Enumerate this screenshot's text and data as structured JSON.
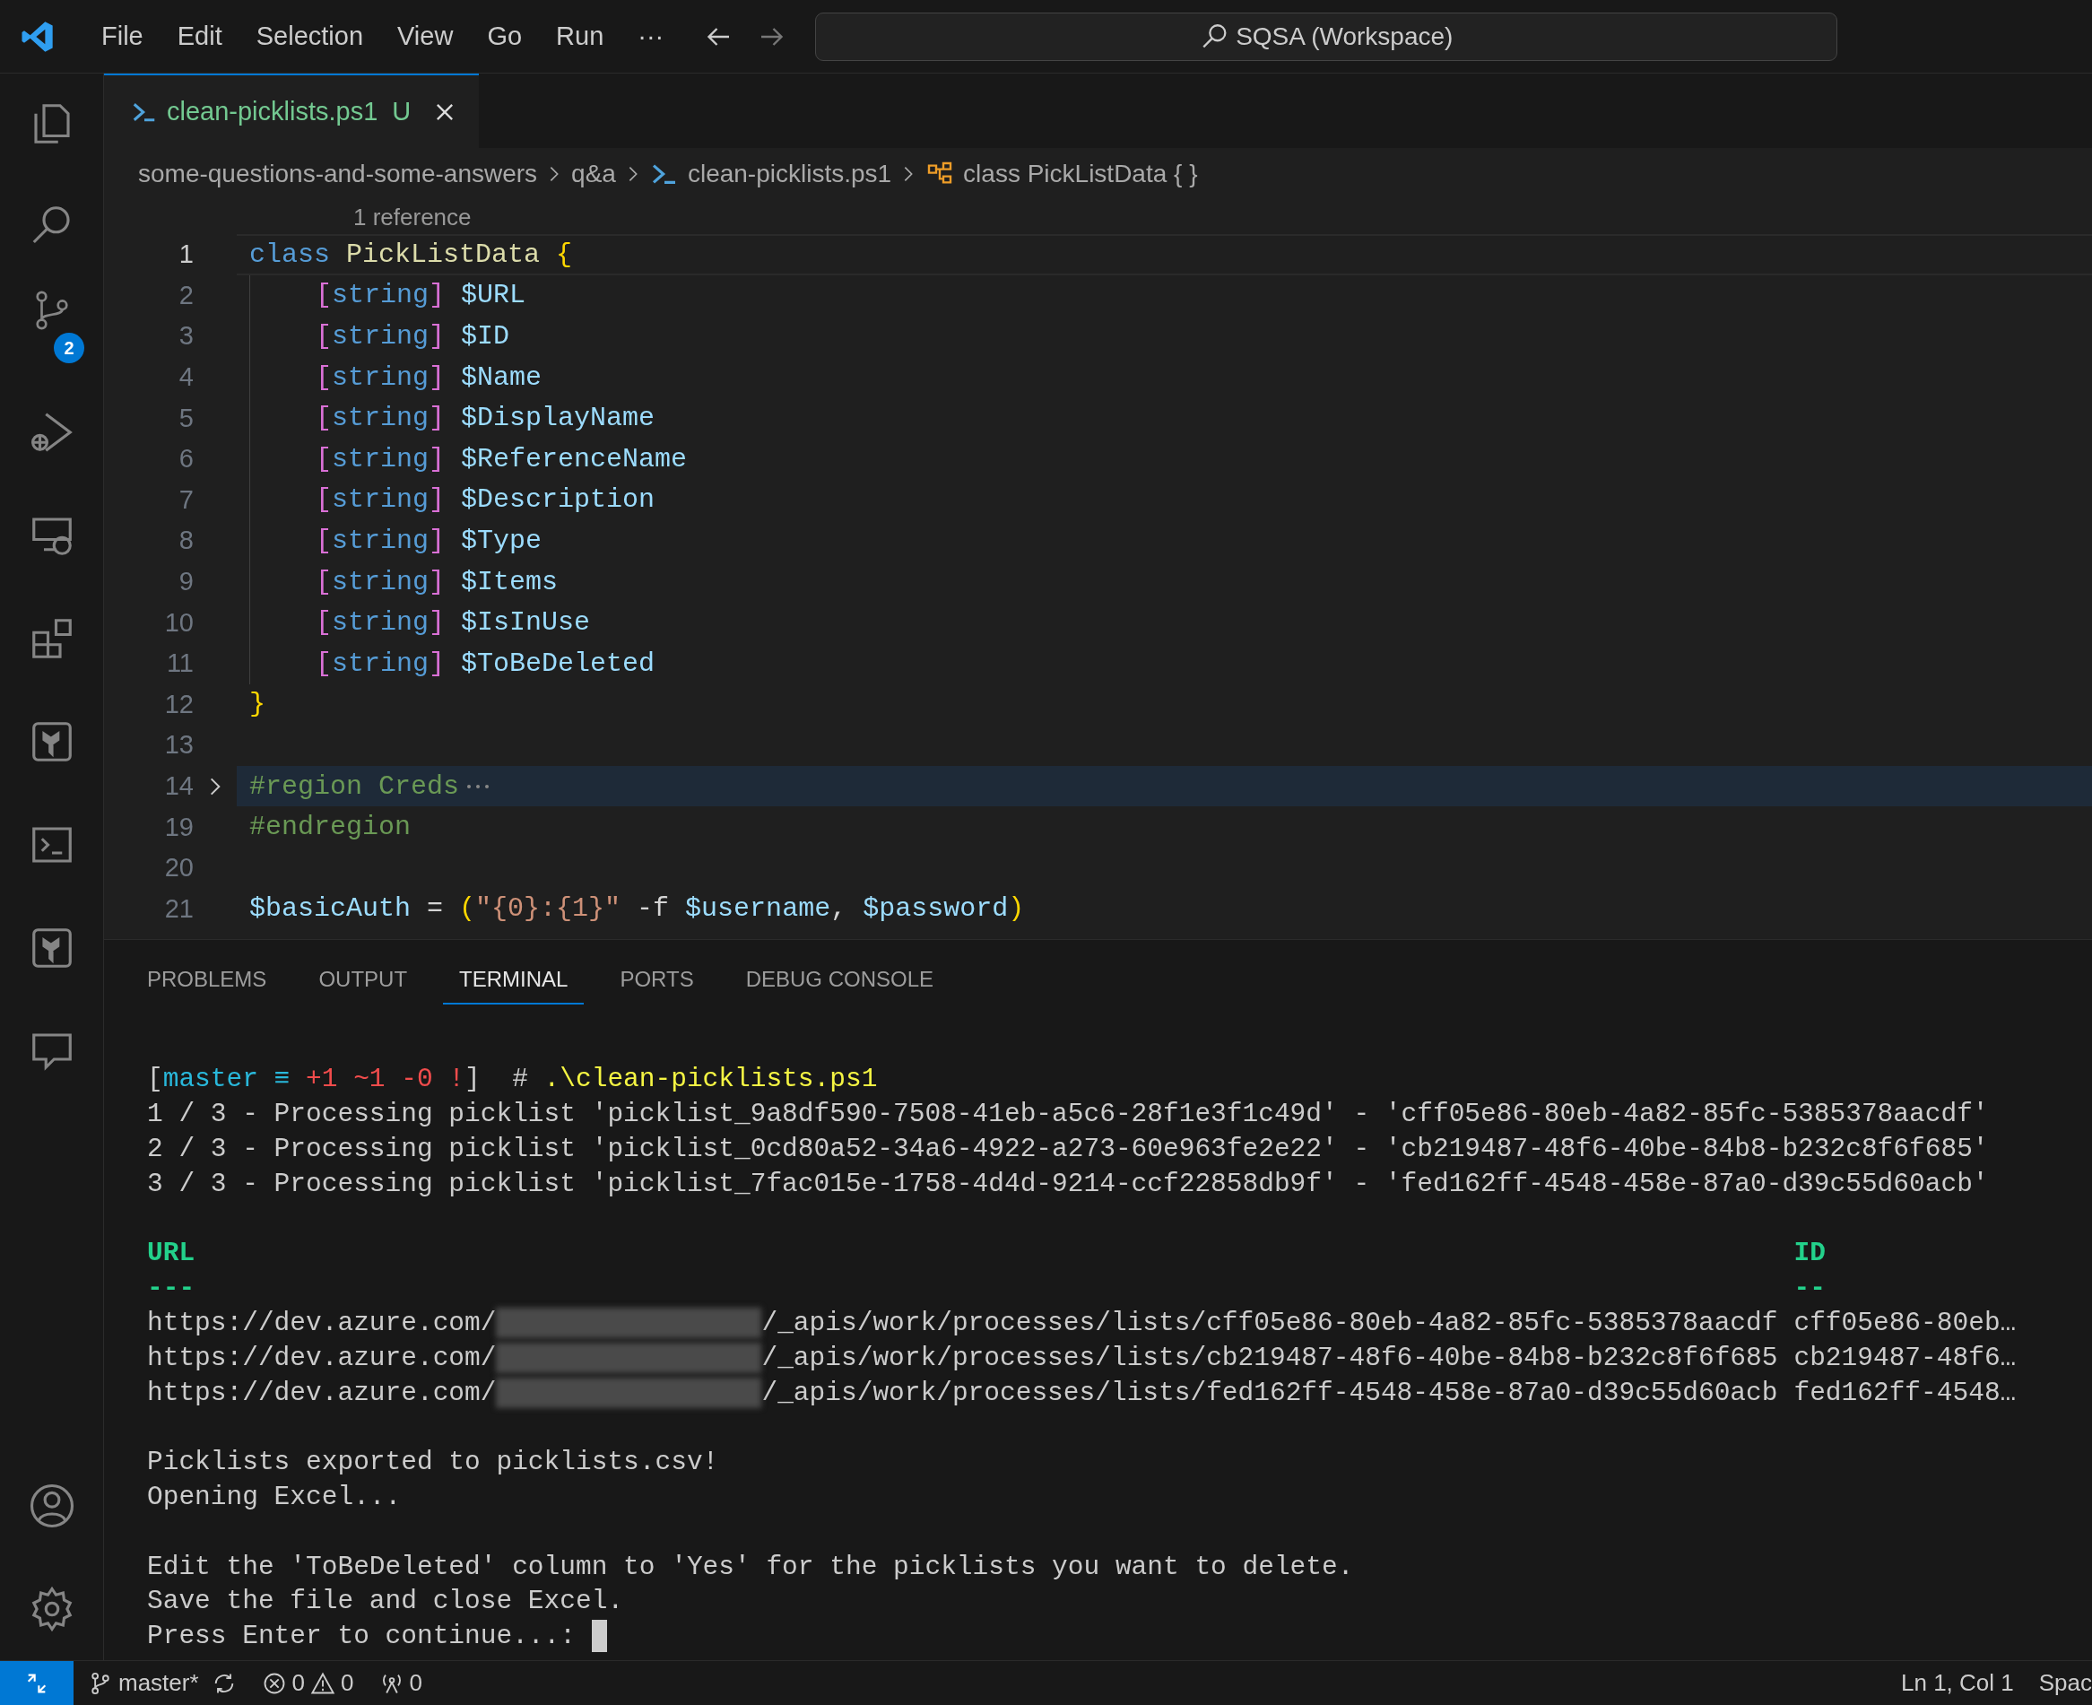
{
  "title_bar": {
    "menu": [
      "File",
      "Edit",
      "Selection",
      "View",
      "Go",
      "Run",
      "···"
    ],
    "search": "SQSA (Workspace)"
  },
  "activity_bar": {
    "items": [
      {
        "kind": "explorer"
      },
      {
        "kind": "search"
      },
      {
        "kind": "source-control",
        "badge": "2"
      },
      {
        "kind": "run-debug"
      },
      {
        "kind": "remote"
      },
      {
        "kind": "extensions"
      },
      {
        "kind": "terraform-cloud"
      },
      {
        "kind": "terminal"
      },
      {
        "kind": "terraform"
      },
      {
        "kind": "feedback"
      }
    ],
    "bottom": [
      {
        "kind": "account"
      },
      {
        "kind": "settings"
      }
    ]
  },
  "tabs": [
    {
      "label": "clean-picklists.ps1",
      "status": "U",
      "selected": true
    }
  ],
  "breadcrumbs": [
    {
      "kind": "folder",
      "label": "some-questions-and-some-answers"
    },
    {
      "kind": "folder",
      "label": "q&a"
    },
    {
      "kind": "file",
      "label": "clean-picklists.ps1"
    },
    {
      "kind": "class",
      "label": "class PickListData { }"
    }
  ],
  "codelens": "1 reference",
  "code": [
    {
      "number": "1",
      "current": true,
      "folded": false,
      "indented": false,
      "tokens": [
        {
          "text": "class",
          "kind": "keyword"
        },
        {
          "text": " PickListData ",
          "kind": "name"
        },
        {
          "text": "{",
          "kind": "brace"
        }
      ]
    },
    {
      "number": "2",
      "current": false,
      "folded": false,
      "indented": true,
      "tokens": [
        {
          "text": "[",
          "kind": "bracket"
        },
        {
          "text": "string",
          "kind": "type"
        },
        {
          "text": "]",
          "kind": "bracket"
        },
        {
          "text": " $URL",
          "kind": "var"
        }
      ]
    },
    {
      "number": "3",
      "current": false,
      "folded": false,
      "indented": true,
      "tokens": [
        {
          "text": "[",
          "kind": "bracket"
        },
        {
          "text": "string",
          "kind": "type"
        },
        {
          "text": "]",
          "kind": "bracket"
        },
        {
          "text": " $ID",
          "kind": "var"
        }
      ]
    },
    {
      "number": "4",
      "current": false,
      "folded": false,
      "indented": true,
      "tokens": [
        {
          "text": "[",
          "kind": "bracket"
        },
        {
          "text": "string",
          "kind": "type"
        },
        {
          "text": "]",
          "kind": "bracket"
        },
        {
          "text": " $Name",
          "kind": "var"
        }
      ]
    },
    {
      "number": "5",
      "current": false,
      "folded": false,
      "indented": true,
      "tokens": [
        {
          "text": "[",
          "kind": "bracket"
        },
        {
          "text": "string",
          "kind": "type"
        },
        {
          "text": "]",
          "kind": "bracket"
        },
        {
          "text": " $DisplayName",
          "kind": "var"
        }
      ]
    },
    {
      "number": "6",
      "current": false,
      "folded": false,
      "indented": true,
      "tokens": [
        {
          "text": "[",
          "kind": "bracket"
        },
        {
          "text": "string",
          "kind": "type"
        },
        {
          "text": "]",
          "kind": "bracket"
        },
        {
          "text": " $ReferenceName",
          "kind": "var"
        }
      ]
    },
    {
      "number": "7",
      "current": false,
      "folded": false,
      "indented": true,
      "tokens": [
        {
          "text": "[",
          "kind": "bracket"
        },
        {
          "text": "string",
          "kind": "type"
        },
        {
          "text": "]",
          "kind": "bracket"
        },
        {
          "text": " $Description",
          "kind": "var"
        }
      ]
    },
    {
      "number": "8",
      "current": false,
      "folded": false,
      "indented": true,
      "tokens": [
        {
          "text": "[",
          "kind": "bracket"
        },
        {
          "text": "string",
          "kind": "type"
        },
        {
          "text": "]",
          "kind": "bracket"
        },
        {
          "text": " $Type",
          "kind": "var"
        }
      ]
    },
    {
      "number": "9",
      "current": false,
      "folded": false,
      "indented": true,
      "tokens": [
        {
          "text": "[",
          "kind": "bracket"
        },
        {
          "text": "string",
          "kind": "type"
        },
        {
          "text": "]",
          "kind": "bracket"
        },
        {
          "text": " $Items",
          "kind": "var"
        }
      ]
    },
    {
      "number": "10",
      "current": false,
      "folded": false,
      "indented": true,
      "tokens": [
        {
          "text": "[",
          "kind": "bracket"
        },
        {
          "text": "string",
          "kind": "type"
        },
        {
          "text": "]",
          "kind": "bracket"
        },
        {
          "text": " $IsInUse",
          "kind": "var"
        }
      ]
    },
    {
      "number": "11",
      "current": false,
      "folded": false,
      "indented": true,
      "tokens": [
        {
          "text": "[",
          "kind": "bracket"
        },
        {
          "text": "string",
          "kind": "type"
        },
        {
          "text": "]",
          "kind": "bracket"
        },
        {
          "text": " $ToBeDeleted",
          "kind": "var"
        }
      ]
    },
    {
      "number": "12",
      "current": false,
      "folded": false,
      "indented": false,
      "tokens": [
        {
          "text": "}",
          "kind": "brace"
        }
      ]
    },
    {
      "number": "13",
      "current": false,
      "folded": false,
      "indented": false
    },
    {
      "number": "14",
      "current": false,
      "folded": true,
      "indented": false,
      "tokens": [
        {
          "text": "#region Creds",
          "kind": "comment"
        }
      ]
    },
    {
      "number": "19",
      "current": false,
      "folded": false,
      "indented": false,
      "tokens": [
        {
          "text": "#endregion",
          "kind": "comment"
        }
      ]
    },
    {
      "number": "20",
      "current": false,
      "folded": false,
      "indented": false
    },
    {
      "number": "21",
      "current": false,
      "folded": false,
      "indented": false,
      "tokens": [
        {
          "text": "$basicAuth",
          "kind": "var"
        },
        {
          "text": " = ",
          "kind": "plain"
        },
        {
          "text": "(",
          "kind": "brace"
        },
        {
          "text": "\"{0}:{1}\"",
          "kind": "string"
        },
        {
          "text": " -f ",
          "kind": "plain"
        },
        {
          "text": "$username",
          "kind": "var"
        },
        {
          "text": ", ",
          "kind": "plain"
        },
        {
          "text": "$password",
          "kind": "var"
        },
        {
          "text": ")",
          "kind": "brace"
        }
      ]
    }
  ],
  "panel_tabs": [
    {
      "label": "PROBLEMS",
      "selected": false
    },
    {
      "label": "OUTPUT",
      "selected": false
    },
    {
      "label": "TERMINAL",
      "selected": true
    },
    {
      "label": "PORTS",
      "selected": false
    },
    {
      "label": "DEBUG CONSOLE",
      "selected": false
    }
  ],
  "terminal": [
    {
      "kind": "line",
      "cursor": false,
      "tokens": [
        {
          "text": "[",
          "kind": "plain"
        },
        {
          "text": "master ≡",
          "kind": "cyan"
        },
        {
          "text": " +1 ~1 -0 !",
          "kind": "red"
        },
        {
          "text": "]  # ",
          "kind": "plain"
        },
        {
          "text": ".\\clean-picklists.ps1",
          "kind": "yellow"
        }
      ]
    },
    {
      "kind": "line",
      "cursor": false,
      "tokens": [
        {
          "text": "1 / 3 - Processing picklist 'picklist_9a8df590-7508-41eb-a5c6-28f1e3f1c49d' - 'cff05e86-80eb-4a82-85fc-5385378aacdf'",
          "kind": "plain"
        }
      ]
    },
    {
      "kind": "line",
      "cursor": false,
      "tokens": [
        {
          "text": "2 / 3 - Processing picklist 'picklist_0cd80a52-34a6-4922-a273-60e963fe2e22' - 'cb219487-48f6-40be-84b8-b232c8f6f685'",
          "kind": "plain"
        }
      ]
    },
    {
      "kind": "line",
      "cursor": false,
      "tokens": [
        {
          "text": "3 / 3 - Processing picklist 'picklist_7fac015e-1758-4d4d-9214-ccf22858db9f' - 'fed162ff-4548-458e-87a0-d39c55d60acb'",
          "kind": "plain"
        }
      ]
    },
    {
      "kind": "blank"
    },
    {
      "kind": "table",
      "headers": [
        "URL",
        "ID"
      ],
      "rules": [
        "---",
        "--"
      ],
      "rows": [
        {
          "url_start": "https://dev.azure.com/",
          "redacted": true,
          "url_end": "/_apis/work/processes/lists/cff05e86-80eb-4a82-85fc-5385378aacdf",
          "id": "cff05e86-80eb…"
        },
        {
          "url_start": "https://dev.azure.com/",
          "redacted": true,
          "url_end": "/_apis/work/processes/lists/cb219487-48f6-40be-84b8-b232c8f6f685",
          "id": "cb219487-48f6…"
        },
        {
          "url_start": "https://dev.azure.com/",
          "redacted": true,
          "url_end": "/_apis/work/processes/lists/fed162ff-4548-458e-87a0-d39c55d60acb",
          "id": "fed162ff-4548…"
        }
      ]
    },
    {
      "kind": "blank"
    },
    {
      "kind": "line",
      "cursor": false,
      "tokens": [
        {
          "text": "Picklists exported to picklists.csv!",
          "kind": "plain"
        }
      ]
    },
    {
      "kind": "line",
      "cursor": false,
      "tokens": [
        {
          "text": "Opening Excel...",
          "kind": "plain"
        }
      ]
    },
    {
      "kind": "blank"
    },
    {
      "kind": "line",
      "cursor": false,
      "tokens": [
        {
          "text": "Edit the 'ToBeDeleted' column to 'Yes' for the picklists you want to delete.",
          "kind": "plain"
        }
      ]
    },
    {
      "kind": "line",
      "cursor": false,
      "tokens": [
        {
          "text": "Save the file and close Excel.",
          "kind": "plain"
        }
      ]
    },
    {
      "kind": "line",
      "cursor": true,
      "tokens": [
        {
          "text": "Press Enter to continue...: ",
          "kind": "plain"
        }
      ]
    }
  ],
  "status_bar": {
    "branch": "master*",
    "errors": "0",
    "warnings": "0",
    "ports": "0",
    "position": "Ln 1, Col 1",
    "indent": "Spac"
  }
}
